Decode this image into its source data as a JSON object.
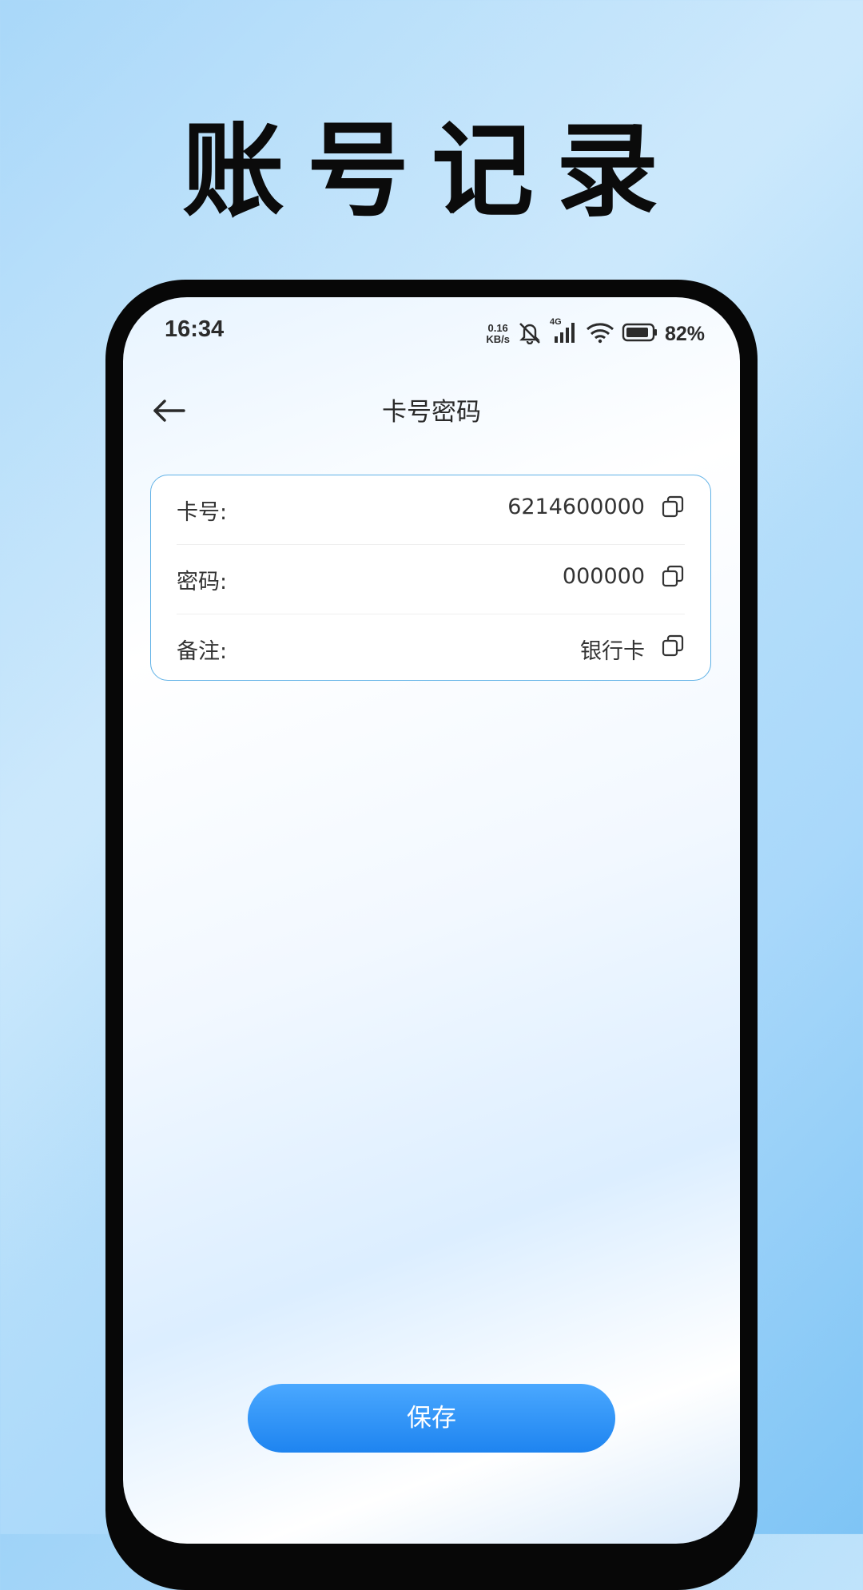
{
  "promo": {
    "title": "账号记录"
  },
  "status_bar": {
    "time": "16:34",
    "net_speed_value": "0.16",
    "net_speed_unit": "KB/s",
    "network": "4G",
    "battery": "82%"
  },
  "header": {
    "title": "卡号密码"
  },
  "fields": [
    {
      "label": "卡号:",
      "value": "6214600000"
    },
    {
      "label": "密码:",
      "value": "000000"
    },
    {
      "label": "备注:",
      "value": "银行卡"
    }
  ],
  "actions": {
    "save_label": "保存"
  },
  "colors": {
    "accent": "#1e84f0",
    "card_border": "#5fb1e6",
    "text": "#333333"
  }
}
